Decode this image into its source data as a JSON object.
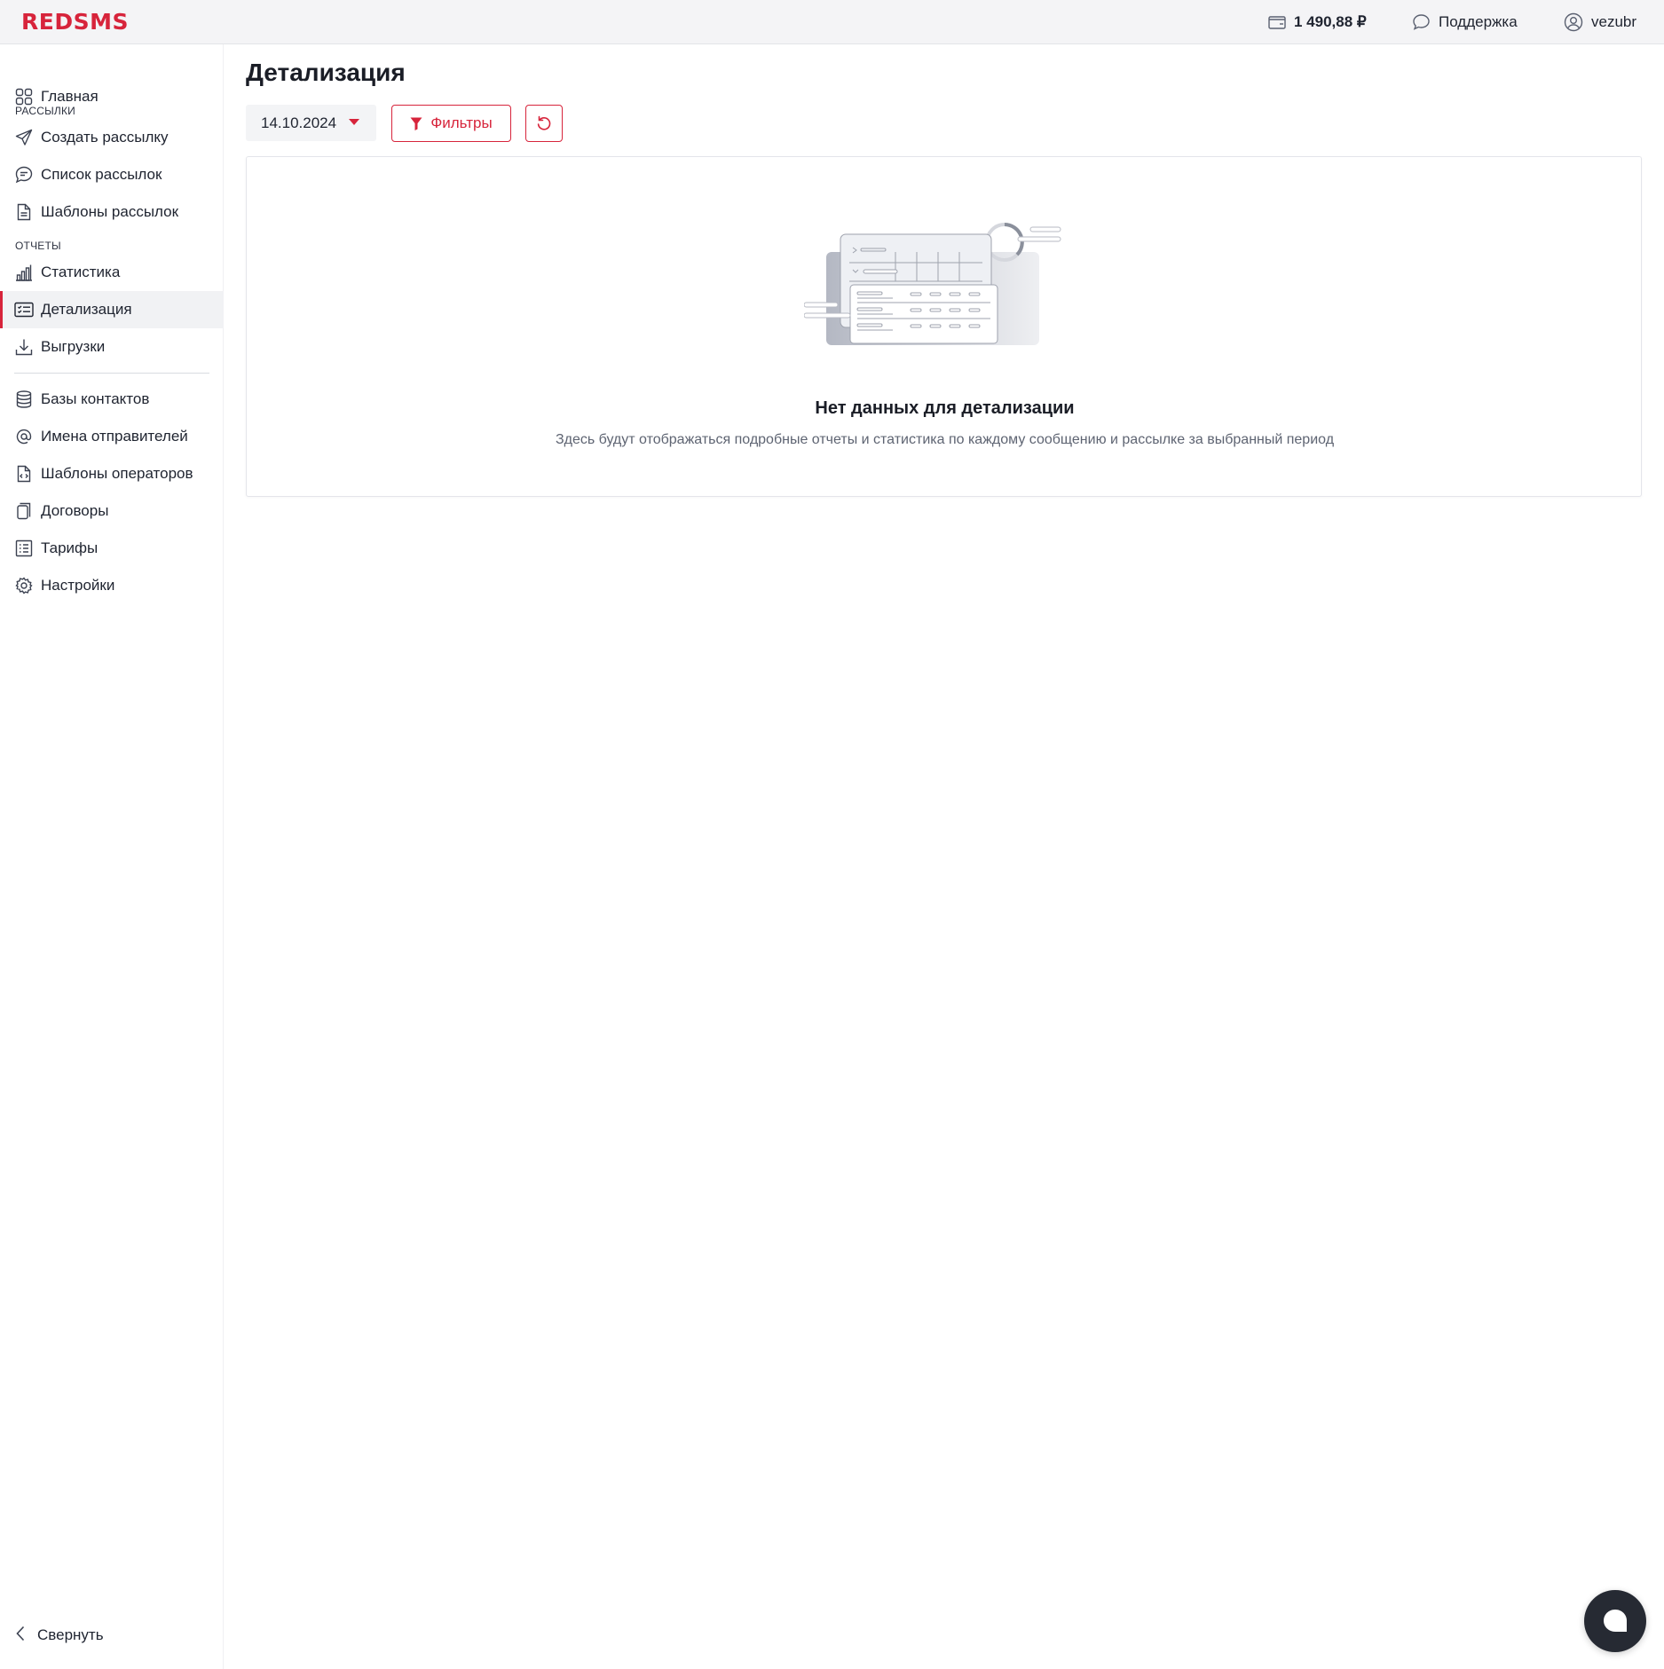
{
  "header": {
    "logo": "REDSMS",
    "balance": "1 490,88 ₽",
    "support": "Поддержка",
    "username": "vezubr"
  },
  "sidebar": {
    "home": "Главная",
    "section_mailings": "РАССЫЛКИ",
    "create_mailing": "Создать рассылку",
    "mailing_list": "Список рассылок",
    "mailing_templates": "Шаблоны рассылок",
    "section_reports": "ОТЧЕТЫ",
    "statistics": "Статистика",
    "details": "Детализация",
    "exports": "Выгрузки",
    "contact_bases": "Базы контактов",
    "sender_names": "Имена отправителей",
    "operator_templates": "Шаблоны операторов",
    "contracts": "Договоры",
    "tariffs": "Тарифы",
    "settings": "Настройки",
    "collapse": "Свернуть",
    "active_item": "details"
  },
  "main": {
    "title": "Детализация",
    "date_value": "14.10.2024",
    "filters_label": "Фильтры",
    "empty_title": "Нет данных для детализации",
    "empty_description": "Здесь будут отображаться подробные отчеты и статистика по каждому сообщению и рассылке за выбранный период"
  },
  "colors": {
    "accent": "#d7243b",
    "text": "#1f2430",
    "muted": "#5e6472"
  },
  "icons": {
    "balance": "wallet-icon",
    "support": "chat-bubble-icon",
    "user": "user-circle-icon",
    "filter": "filter-icon",
    "reset": "refresh-icon",
    "chat": "live-chat-icon"
  }
}
